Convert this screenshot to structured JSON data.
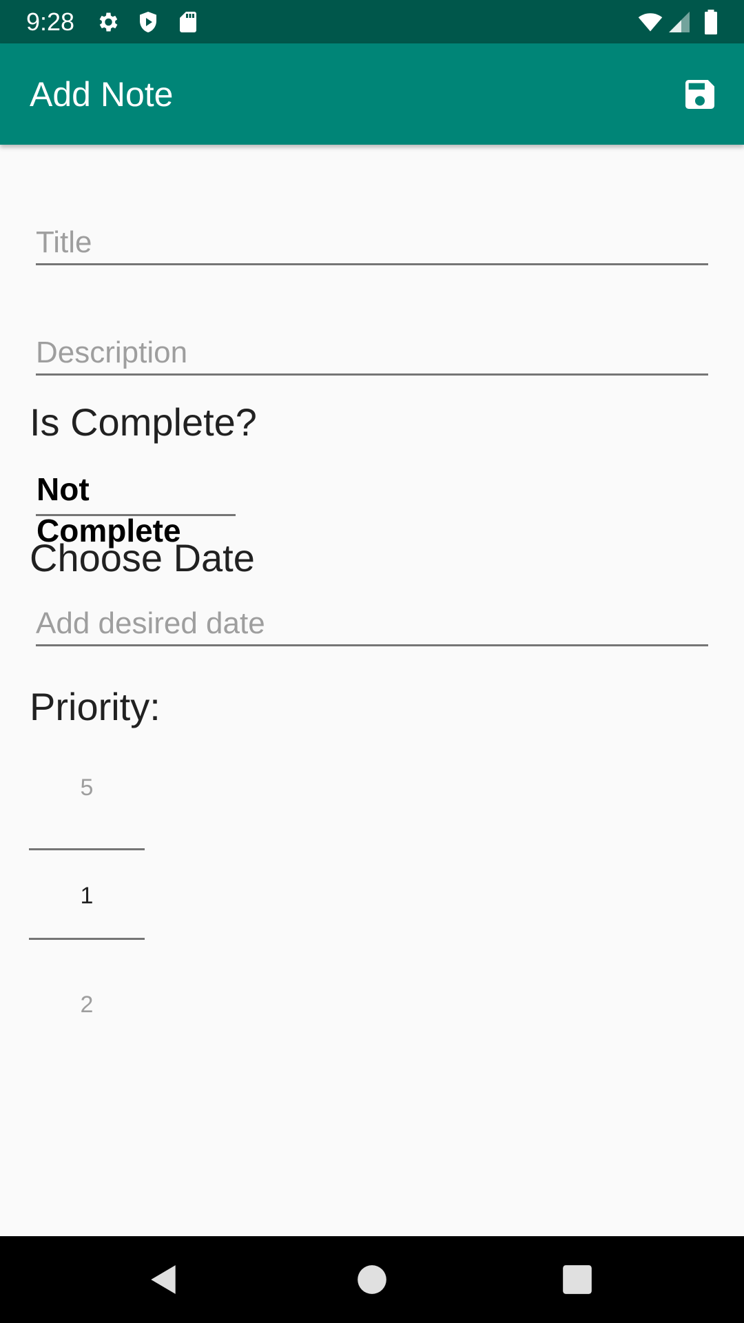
{
  "status_bar": {
    "time": "9:28",
    "icons": [
      "gear-icon",
      "shield-play-icon",
      "sd-card-icon",
      "wifi-icon",
      "signal-icon",
      "battery-icon"
    ]
  },
  "app_bar": {
    "title": "Add Note",
    "save_icon": "save-icon"
  },
  "form": {
    "title_placeholder": "Title",
    "title_value": "",
    "description_placeholder": "Description",
    "description_value": "",
    "complete_label": "Is Complete?",
    "complete_selected": "Not Complete",
    "date_label": "Choose Date",
    "date_placeholder": "Add desired date",
    "date_value": "",
    "priority_label": "Priority:",
    "priority_picker": {
      "previous": "5",
      "selected": "1",
      "next": "2"
    }
  },
  "nav_bar": {
    "icons": [
      "back-icon",
      "home-icon",
      "recents-icon"
    ]
  },
  "colors": {
    "status_bar": "#00574b",
    "app_bar": "#008577",
    "background": "#fafafa"
  }
}
